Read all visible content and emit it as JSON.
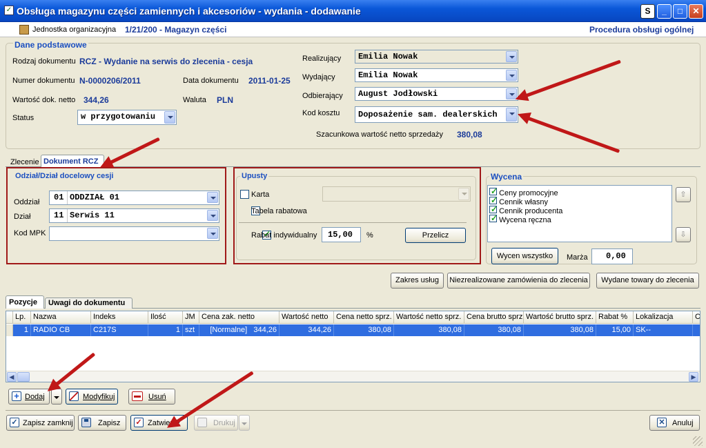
{
  "window": {
    "title": "Obsługa magazynu części zamiennych i akcesoriów - wydania - dodawanie",
    "btn_s": "S"
  },
  "org": {
    "label": "Jednostka organizacyjna",
    "value": "1/21/200 - Magazyn części",
    "procedure": "Procedura obsługi ogólnej"
  },
  "basic": {
    "title": "Dane podstawowe",
    "rodzaj_label": "Rodzaj dokumentu",
    "rodzaj_value": "RCZ - Wydanie na serwis do zlecenia - cesja",
    "numer_label": "Numer dokumentu",
    "numer_value": "N-0000206/2011",
    "data_label": "Data dokumentu",
    "data_value": "2011-01-25",
    "wartosc_label": "Wartość dok. netto",
    "wartosc_value": "344,26",
    "waluta_label": "Waluta",
    "waluta_value": "PLN",
    "status_label": "Status",
    "status_value": "w przygotowaniu",
    "realizujacy_label": "Realizujący",
    "realizujacy_value": "Emilia Nowak",
    "wydajacy_label": "Wydający",
    "wydajacy_value": "Emilia Nowak",
    "odbierajacy_label": "Odbierający",
    "odbierajacy_value": "August Jodłowski",
    "kod_kosztu_label": "Kod kosztu",
    "kod_kosztu_value": "Doposażenie sam. dealerskich",
    "szac_label": "Szacunkowa wartość netto sprzedaży",
    "szac_value": "380,08"
  },
  "doc_tabs": {
    "zlecenie": "Zlecenie",
    "dokument": "Dokument RCZ"
  },
  "odzial": {
    "title": "Odział/Dział docelowy cesji",
    "oddzial_label": "Oddział",
    "oddzial_code": "01",
    "oddzial_name": "ODDZIAŁ 01",
    "dzial_label": "Dział",
    "dzial_code": "11",
    "dzial_name": "Serwis 11",
    "mpk_label": "Kod MPK",
    "mpk_value": ""
  },
  "upusty": {
    "title": "Upusty",
    "karta": "Karta",
    "tabela": "Tabela rabatowa",
    "rabat": "Rabat indywidualny",
    "rabat_value": "15,00",
    "percent": "%",
    "przelicz": "Przelicz"
  },
  "wycena": {
    "title": "Wycena",
    "items": [
      "Ceny promocyjne",
      "Cennik własny",
      "Cennik producenta",
      "Wycena ręczna"
    ],
    "wycen_btn": "Wycen wszystko",
    "marza_label": "Marża",
    "marza_value": "0,00"
  },
  "actions": {
    "zakres": "Zakres usług",
    "niezrealizowane": "Niezrealizowane zamówienia do zlecenia",
    "wydane": "Wydane towary do zlecenia"
  },
  "list_tabs": {
    "pozycje": "Pozycje",
    "uwagi": "Uwagi do dokumentu"
  },
  "grid": {
    "headers": [
      "Lp.",
      "Nazwa",
      "Indeks",
      "Ilość",
      "JM",
      "Cena zak. netto",
      "Wartość netto",
      "Cena netto sprz.",
      "Wartość netto sprz.",
      "Cena brutto sprz.",
      "Wartość brutto sprz.",
      "Rabat %",
      "Lokalizacja",
      "Ce"
    ],
    "rows": [
      [
        "1",
        "RADIO CB",
        "C217S",
        "1",
        "szt",
        "[Normalne]   344,26",
        "344,26",
        "380,08",
        "380,08",
        "380,08",
        "380,08",
        "15,00",
        "SK--",
        ""
      ]
    ]
  },
  "row_buttons": {
    "dodaj": "Dodaj",
    "modyfikuj": "Modyfikuj",
    "usun": "Usuń"
  },
  "bottom_buttons": {
    "zapisz_zamknij": "Zapisz zamknij",
    "zapisz": "Zapisz",
    "zatwierdz": "Zatwierdź",
    "drukuj": "Drukuj",
    "anuluj": "Anuluj"
  },
  "colors": {
    "accent_blue": "#1b3b9a",
    "highlight_red": "#a01818",
    "title_bar": "#0a57d8",
    "selection": "#2f6de0"
  }
}
